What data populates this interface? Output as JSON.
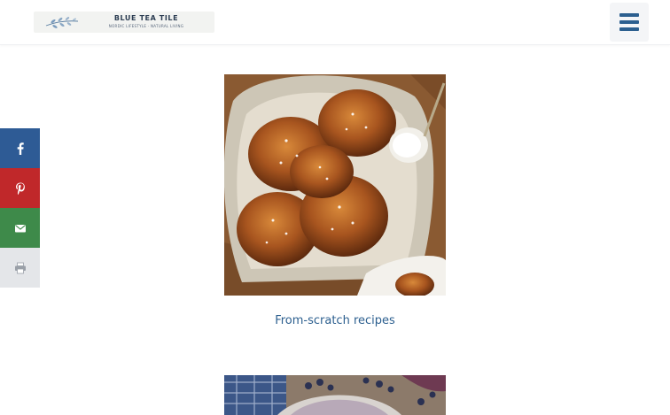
{
  "header": {
    "logo": {
      "title": "BLUE TEA TILE",
      "tagline": "NORDIC LIFESTYLE · NATURAL LIVING"
    },
    "menu_icon": "hamburger-menu-icon"
  },
  "share_bar": {
    "items": [
      {
        "name": "facebook",
        "icon": "facebook-icon",
        "color": "#2e5b95"
      },
      {
        "name": "pinterest",
        "icon": "pinterest-icon",
        "color": "#c0282a"
      },
      {
        "name": "email",
        "icon": "email-icon",
        "color": "#3e8a4a"
      },
      {
        "name": "print",
        "icon": "print-icon",
        "color": "#e4e6e9"
      }
    ]
  },
  "main": {
    "cards": [
      {
        "caption": "From-scratch recipes",
        "image": "cardamom-buns-photo"
      },
      {
        "caption": "",
        "image": "blueberry-photo"
      }
    ]
  },
  "colors": {
    "accent": "#2c5f8f",
    "link": "#2c5f8f"
  }
}
